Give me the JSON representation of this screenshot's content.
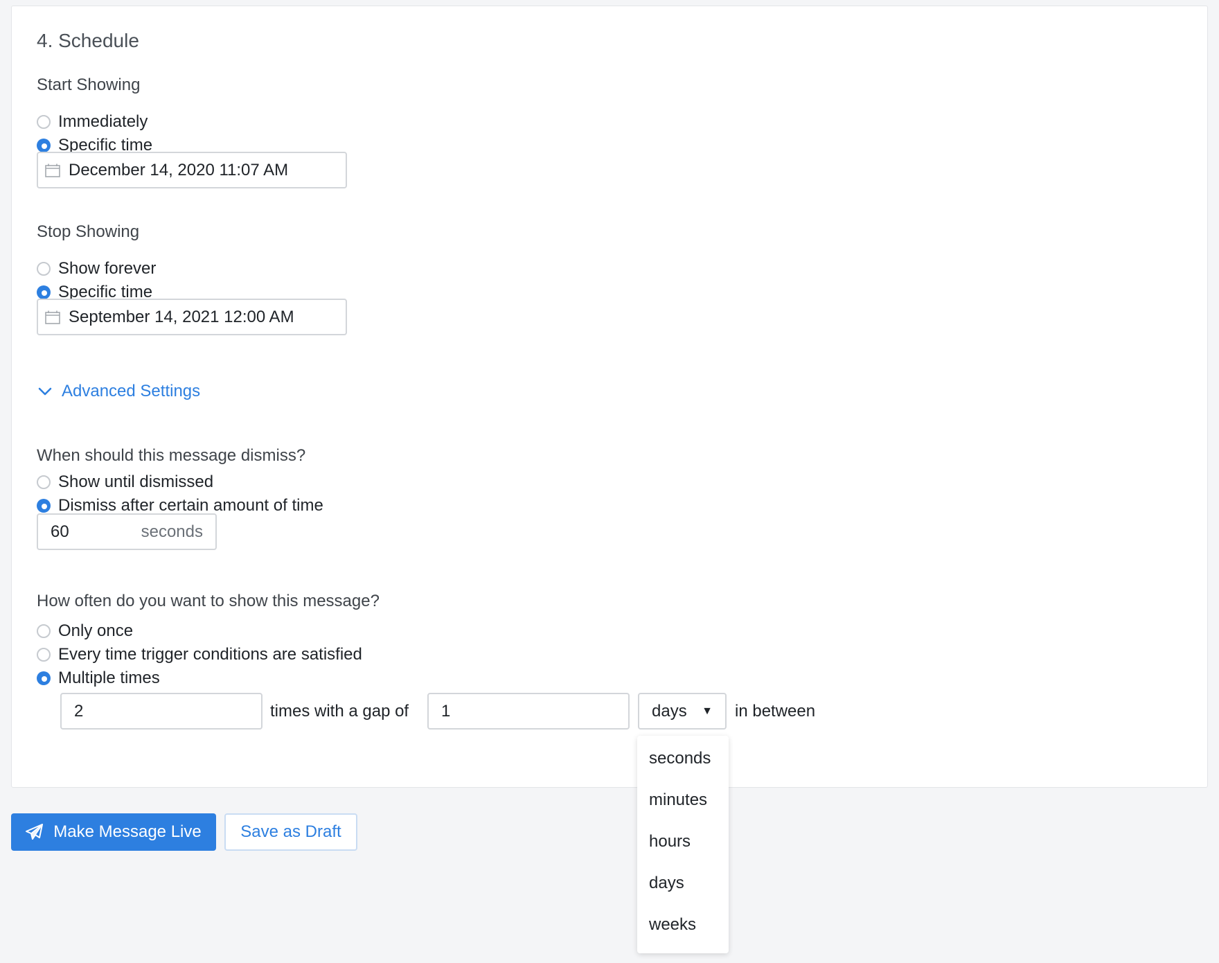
{
  "section": {
    "title": "4. Schedule"
  },
  "start": {
    "label": "Start Showing",
    "options": [
      "Immediately",
      "Specific time"
    ],
    "selected": 1,
    "datetime": "December 14, 2020 11:07 AM"
  },
  "stop": {
    "label": "Stop Showing",
    "options": [
      "Show forever",
      "Specific time"
    ],
    "selected": 1,
    "datetime": "September 14, 2021 12:00 AM"
  },
  "advanced": {
    "label": "Advanced Settings",
    "expanded": true
  },
  "dismiss": {
    "question": "When should this message dismiss?",
    "options": [
      "Show until dismissed",
      "Dismiss after certain amount of time"
    ],
    "selected": 1,
    "value": "60",
    "unit": "seconds"
  },
  "frequency": {
    "question": "How often do you want to show this message?",
    "options": [
      "Only once",
      "Every time trigger conditions are satisfied",
      "Multiple times"
    ],
    "selected": 2,
    "times_value": "2",
    "times_label": "times with a gap of",
    "gap_value": "1",
    "gap_unit": "days",
    "suffix": "in between",
    "unit_options": [
      "seconds",
      "minutes",
      "hours",
      "days",
      "weeks"
    ]
  },
  "actions": {
    "primary": "Make Message Live",
    "secondary": "Save as Draft"
  },
  "colors": {
    "accent": "#2d7fe0",
    "background": "#f4f5f7",
    "card": "#ffffff",
    "border": "#d3d6da"
  }
}
